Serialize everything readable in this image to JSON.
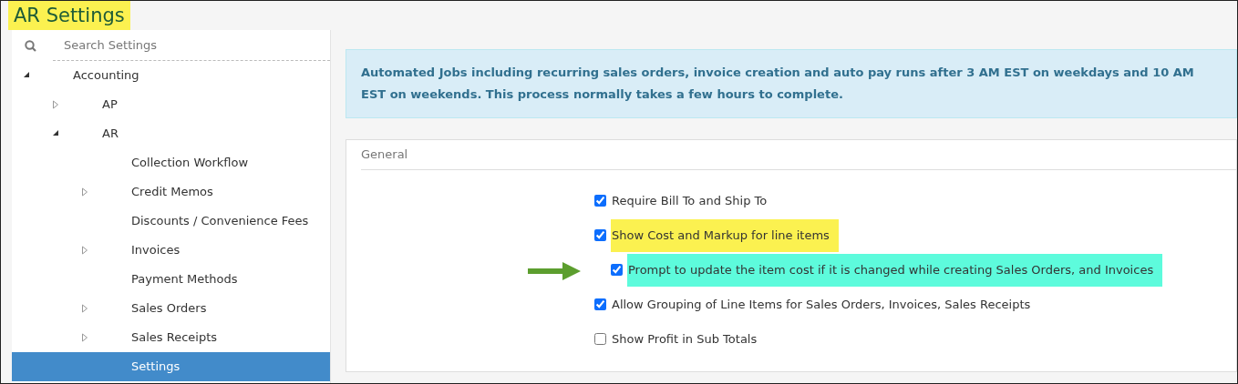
{
  "title": {
    "text": "AR Settings",
    "color": "#fbf150"
  },
  "search": {
    "placeholder": "Search Settings"
  },
  "tree": [
    {
      "label": "Accounting",
      "kind": "folder",
      "expanded": true,
      "selected": false,
      "children": [
        {
          "label": "AP",
          "kind": "folder",
          "expanded": false,
          "selected": false
        },
        {
          "label": "AR",
          "kind": "folder",
          "expanded": true,
          "selected": false,
          "children": [
            {
              "label": "Collection Workflow",
              "kind": "leaf",
              "selected": false
            },
            {
              "label": "Credit Memos",
              "kind": "folder",
              "expanded": false,
              "selected": false
            },
            {
              "label": "Discounts / Convenience Fees",
              "kind": "leaf",
              "selected": false
            },
            {
              "label": "Invoices",
              "kind": "folder",
              "expanded": false,
              "selected": false
            },
            {
              "label": "Payment Methods",
              "kind": "leaf",
              "selected": false
            },
            {
              "label": "Sales Orders",
              "kind": "folder",
              "expanded": false,
              "selected": false
            },
            {
              "label": "Sales Receipts",
              "kind": "folder",
              "expanded": false,
              "selected": false
            },
            {
              "label": "Settings",
              "kind": "leaf",
              "selected": true
            }
          ]
        }
      ]
    }
  ],
  "notice": "Automated Jobs including recurring sales orders, invoice creation and auto pay runs after 3 AM EST on weekdays and 10 AM EST on weekends. This process normally takes a few hours to complete.",
  "panel": {
    "title": "General",
    "options": [
      {
        "label": "Require Bill To and Ship To",
        "checked": true,
        "kind": "main"
      },
      {
        "label": "Show Cost and Markup for line items",
        "checked": true,
        "kind": "main",
        "color": "#fbf150"
      },
      {
        "label": "Prompt to update the item cost if it is changed while creating Sales Orders, and Invoices",
        "checked": true,
        "kind": "sub",
        "color": "#5dfbdc",
        "pointer": true
      },
      {
        "label": "Allow Grouping of Line Items for Sales Orders, Invoices, Sales Receipts",
        "checked": true,
        "kind": "main"
      },
      {
        "label": "Show Profit in Sub Totals",
        "checked": false,
        "kind": "main"
      }
    ]
  }
}
